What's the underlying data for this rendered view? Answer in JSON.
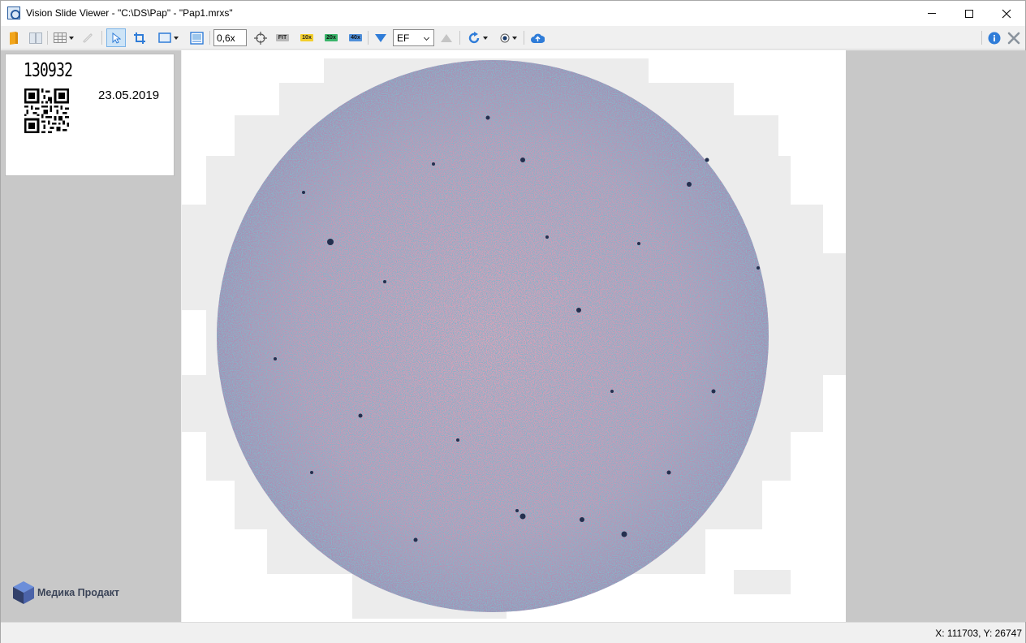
{
  "window": {
    "title": "Vision Slide Viewer - \"C:\\DS\\Pap\" - \"Pap1.mrxs\""
  },
  "toolbar": {
    "zoom_value": "0,6x",
    "fit_label": "FIT",
    "mag_10_label": "10x",
    "mag_20_label": "20x",
    "mag_40_label": "40x",
    "filter_value": "EF",
    "icons": [
      "open-folder-icon",
      "side-by-side-icon",
      "grid-icon",
      "link-icon",
      "pointer-icon",
      "crop-icon",
      "rectangle-select-icon",
      "screenshot-icon",
      "center-target-icon",
      "arrow-down-icon",
      "arrow-up-icon",
      "rotate-icon",
      "focus-icon",
      "upload-icon",
      "info-icon",
      "tools-icon"
    ],
    "mag_colors": {
      "fit": "#b9b9b9",
      "mag_10": "#f3cf2c",
      "mag_20": "#39b56a",
      "mag_40": "#4f8fd9"
    },
    "accent_color": "#2f7cd8"
  },
  "slide_label": {
    "id_text": "130932",
    "date": "23.05.2019"
  },
  "logo": {
    "text": "Медика Продакт"
  },
  "status": {
    "coordinates": "X: 111703, Y: 26747"
  }
}
